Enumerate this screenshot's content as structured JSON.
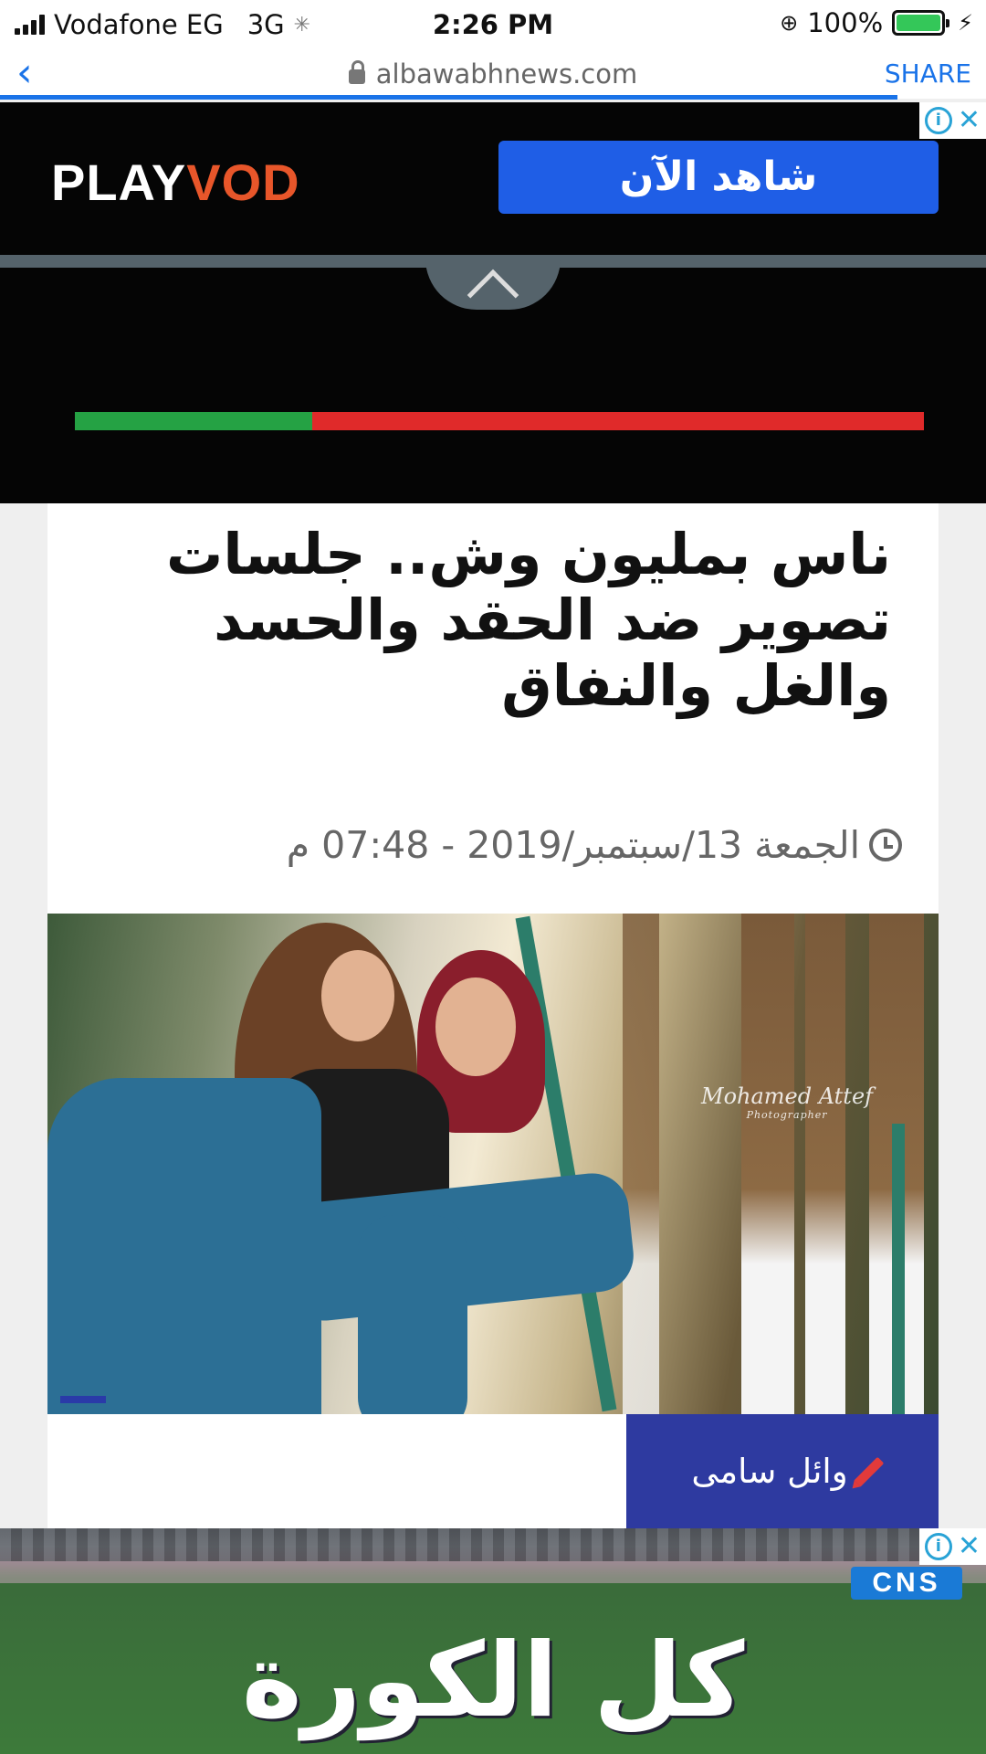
{
  "status_bar": {
    "carrier": "Vodafone EG",
    "network": "3G",
    "time": "2:26 PM",
    "battery": "100%"
  },
  "browser": {
    "back_icon": "chevron-left-icon",
    "url": "albawabhnews.com",
    "share_label": "SHARE",
    "load_progress": 0.91
  },
  "top_ad": {
    "brand_play": "PLAY",
    "brand_vod": "VOD",
    "cta": "شاهد الآن"
  },
  "video": {
    "progress": 0.28,
    "colors": {
      "played": "#25a244",
      "remaining": "#e02a2a"
    }
  },
  "article": {
    "headline": "ناس بمليون وش.. جلسات تصوير ضد الحقد والحسد والغل والنفاق",
    "date": "الجمعة 13/سبتمبر/2019 - 07:48 م",
    "photo_watermark": "Mohamed Attef",
    "photo_watermark_sub": "Photographer",
    "author": "وائل سامى"
  },
  "bottom_ad": {
    "logo": "CNS",
    "text": "كل الكورة"
  },
  "colors": {
    "link": "#1a73e8",
    "author_bg": "#2e3aa0",
    "ad_cta_bg": "#1f5ee6"
  }
}
